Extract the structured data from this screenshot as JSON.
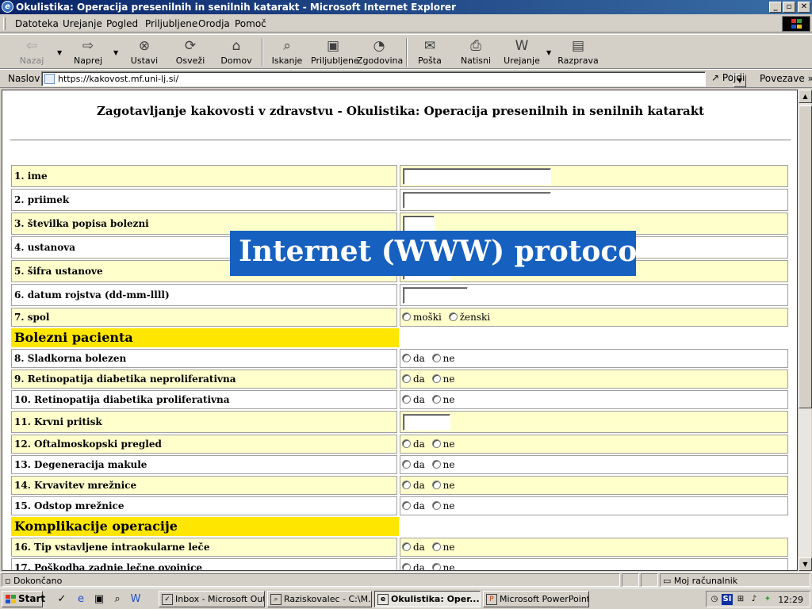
{
  "window": {
    "title": "Okulistika: Operacija presenilnih in senilnih katarakt - Microsoft Internet Explorer",
    "min_glyph": "_",
    "max_glyph": "▫",
    "close_glyph": "✕"
  },
  "menu": [
    "Datoteka",
    "Urejanje",
    "Pogled",
    "Priljubljene",
    "Orodja",
    "Pomoč"
  ],
  "toolbar": {
    "back": "Nazaj",
    "forward": "Naprej",
    "stop": "Ustavi",
    "refresh": "Osveži",
    "home": "Domov",
    "search": "Iskanje",
    "favorites": "Priljubljene",
    "history": "Zgodovina",
    "mail": "Pošta",
    "print": "Natisni",
    "edit": "Urejanje",
    "discuss": "Razprava"
  },
  "address": {
    "label": "Naslov",
    "url": "https://kakovost.mf.uni-lj.si/",
    "go": "Pojdi",
    "links": "Povezave"
  },
  "page": {
    "title": "Zagotavljanje kakovosti v zdravstvu - Okulistika: Operacija presenilnih in senilnih katarakt",
    "fields": {
      "f1": "1. ime",
      "f2": "2. priimek",
      "f3": "3. številka popisa bolezni",
      "f4": "4. ustanova",
      "f5": "5. šifra ustanove",
      "f6": "6. datum rojstva (dd-mm-llll)",
      "f7": "7. spol",
      "f8": "8. Sladkorna bolezen",
      "f9": "9. Retinopatija diabetika neproliferativna",
      "f10": "10. Retinopatija diabetika proliferativna",
      "f11": "11. Krvni pritisk",
      "f12": "12. Oftalmoskopski pregled",
      "f13": "13. Degeneracija makule",
      "f14": "14. Krvavitev mrežnice",
      "f15": "15. Odstop mrežnice",
      "f16": "16. Tip vstavljene intraokularne leče",
      "f17": "17. Poškodba zadnje lečne ovojnice"
    },
    "section1": "Bolezni pacienta",
    "section2": "Komplikacije operacije",
    "opt_yes": "da",
    "opt_no": "ne",
    "opt_male": "moški",
    "opt_female": "ženski"
  },
  "overlay": "Internet (WWW) protocol",
  "status": {
    "done": "Dokončano",
    "zone": "Moj računalnik"
  },
  "taskbar": {
    "start": "Start",
    "tasks": [
      "Inbox - Microsoft Outl...",
      "Raziskovalec - C:\\M...",
      "Okulistika: Oper...",
      "Microsoft PowerPoint..."
    ],
    "lang": "SI",
    "clock": "12:29"
  }
}
